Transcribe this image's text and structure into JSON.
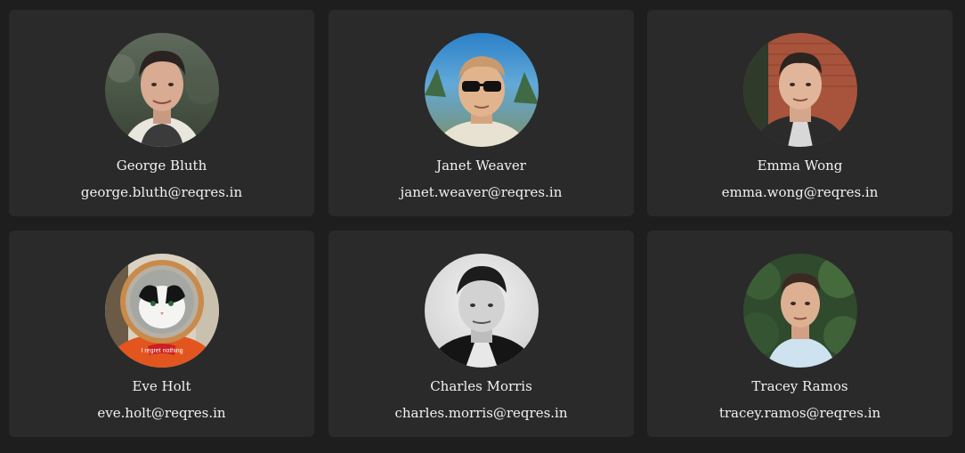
{
  "users": [
    {
      "name": "George Bluth",
      "email": "george.bluth@reqres.in"
    },
    {
      "name": "Janet Weaver",
      "email": "janet.weaver@reqres.in"
    },
    {
      "name": "Emma Wong",
      "email": "emma.wong@reqres.in"
    },
    {
      "name": "Eve Holt",
      "email": "eve.holt@reqres.in"
    },
    {
      "name": "Charles Morris",
      "email": "charles.morris@reqres.in"
    },
    {
      "name": "Tracey Ramos",
      "email": "tracey.ramos@reqres.in"
    }
  ],
  "avatar_photo_captions": [
    "",
    "",
    "",
    "I regret nothing",
    "",
    ""
  ],
  "colors": {
    "page_background": "#1e1e1e",
    "card_background": "#2a2a2a",
    "text": "#f2f2f2"
  }
}
